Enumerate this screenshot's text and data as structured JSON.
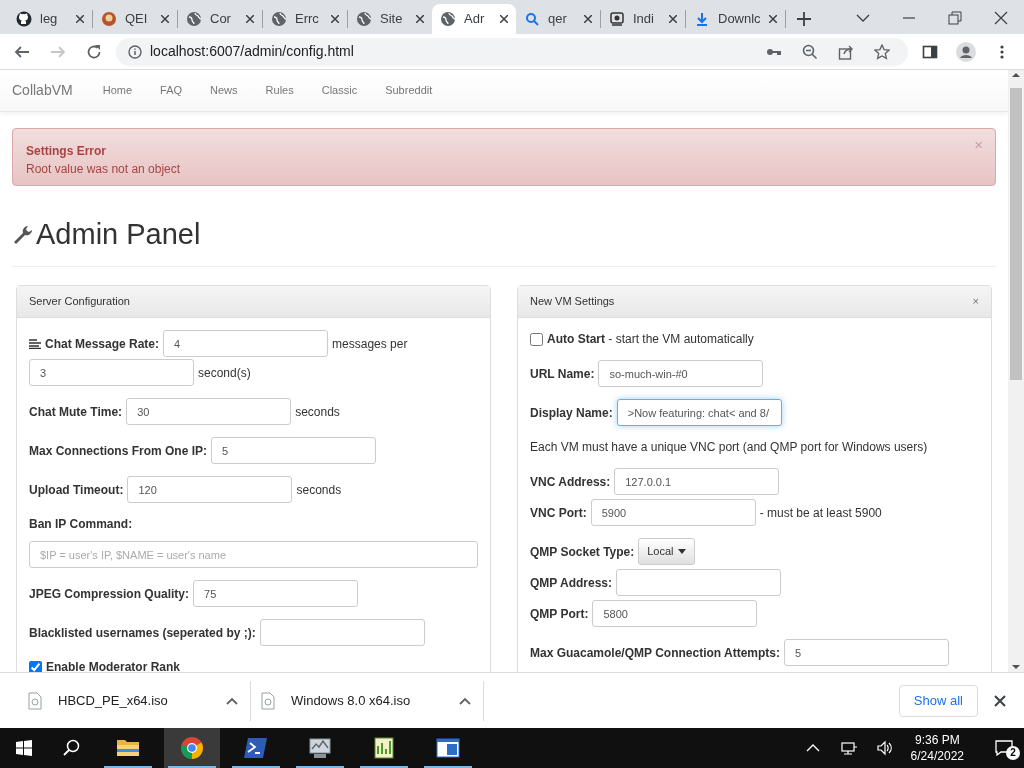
{
  "browser": {
    "tabs": [
      {
        "title": "leg",
        "kind": "github",
        "selected": false
      },
      {
        "title": "QEI",
        "kind": "logo",
        "selected": false
      },
      {
        "title": "Cor",
        "kind": "globe",
        "selected": false
      },
      {
        "title": "Errc",
        "kind": "globe",
        "selected": false
      },
      {
        "title": "Site",
        "kind": "globe",
        "selected": false
      },
      {
        "title": "Adr",
        "kind": "globe",
        "selected": true
      },
      {
        "title": "qer",
        "kind": "search",
        "selected": false
      },
      {
        "title": "Indi",
        "kind": "app",
        "selected": false
      },
      {
        "title": "Downlc",
        "kind": "download",
        "selected": false
      }
    ],
    "forward_disabled": true,
    "address": "localhost:6007/admin/config.html"
  },
  "navbar": {
    "brand": "CollabVM",
    "links": [
      "Home",
      "FAQ",
      "News",
      "Rules",
      "Classic",
      "Subreddit"
    ]
  },
  "alert": {
    "title": "Settings Error",
    "message": "Root value was not an object",
    "close": "×"
  },
  "heading": "Admin Panel",
  "panels": [
    {
      "title": "Server Configuration",
      "groups": [
        [
          [
            {
              "kind": "icon"
            },
            {
              "kind": "label",
              "text": "Chat Message Rate:"
            },
            {
              "kind": "input",
              "value": "4"
            },
            {
              "kind": "text",
              "text": "messages per"
            },
            {
              "kind": "input",
              "value": "3"
            },
            {
              "kind": "text",
              "text": "second(s)"
            }
          ]
        ],
        [
          [
            {
              "kind": "label",
              "text": "Chat Mute Time:"
            },
            {
              "kind": "input",
              "value": "30"
            },
            {
              "kind": "text",
              "text": "seconds"
            }
          ]
        ],
        [
          [
            {
              "kind": "label",
              "text": "Max Connections From One IP:"
            },
            {
              "kind": "input",
              "value": "5"
            }
          ]
        ],
        [
          [
            {
              "kind": "label",
              "text": "Upload Timeout:"
            },
            {
              "kind": "input",
              "value": "120"
            },
            {
              "kind": "text",
              "text": "seconds"
            }
          ]
        ],
        [
          [
            {
              "kind": "label",
              "text": "Ban IP Command:"
            }
          ],
          [
            {
              "kind": "wide-input",
              "placeholder": "$IP = user's IP, $NAME = user's name"
            }
          ]
        ],
        [
          [
            {
              "kind": "label",
              "text": "JPEG Compression Quality:"
            },
            {
              "kind": "input",
              "value": "75"
            }
          ]
        ],
        [
          [
            {
              "kind": "label",
              "text": "Blacklisted usernames (seperated by ;):"
            },
            {
              "kind": "input"
            }
          ]
        ],
        [
          [
            {
              "kind": "checkbox",
              "text": "Enable Moderator Rank",
              "checked": true
            }
          ]
        ]
      ]
    },
    {
      "title": "New VM Settings",
      "close": "×",
      "groups": [
        [
          [
            {
              "kind": "checkbox",
              "text": "**Auto Start** - start the VM automatically",
              "checked": false
            }
          ]
        ],
        [
          [
            {
              "kind": "label",
              "text": "URL Name:"
            },
            {
              "kind": "input",
              "value": "so-much-win-#0",
              "focused": false
            }
          ]
        ],
        [
          [
            {
              "kind": "label",
              "text": "Display Name:"
            },
            {
              "kind": "input",
              "value": ">Now featuring: chat< and 8/",
              "focused": true
            }
          ]
        ],
        [
          [
            {
              "kind": "text",
              "text": "Each VM must have a unique VNC port (and QMP port for Windows users)"
            }
          ]
        ],
        [
          [
            {
              "kind": "label",
              "text": "VNC Address:"
            },
            {
              "kind": "input",
              "value": "127.0.0.1"
            }
          ],
          [
            {
              "kind": "label",
              "text": "VNC Port:"
            },
            {
              "kind": "input",
              "value": "5900"
            },
            {
              "kind": "text",
              "text": "- must be at least 5900"
            }
          ]
        ],
        [
          [
            {
              "kind": "label",
              "text": "QMP Socket Type:"
            },
            {
              "kind": "dropdown",
              "text": "Local"
            }
          ],
          [
            {
              "kind": "label",
              "text": "QMP Address:"
            },
            {
              "kind": "input"
            }
          ],
          [
            {
              "kind": "label",
              "text": "QMP Port:"
            },
            {
              "kind": "input",
              "value": "5800"
            }
          ]
        ],
        [
          [
            {
              "kind": "label",
              "text": "Max Guacamole/QMP Connection Attempts:"
            },
            {
              "kind": "input",
              "value": "5"
            }
          ]
        ]
      ]
    }
  ],
  "downloads": {
    "items": [
      "HBCD_PE_x64.iso",
      "Windows 8.0 x64.iso"
    ],
    "show_all": "Show all"
  },
  "taskbar": {
    "apps": [
      {
        "kind": "folder",
        "running": true,
        "active": false
      },
      {
        "kind": "chrome",
        "running": true,
        "active": true
      },
      {
        "kind": "shell",
        "running": true,
        "active": false
      },
      {
        "kind": "monitor",
        "running": true,
        "active": false
      },
      {
        "kind": "chart",
        "running": true,
        "active": false
      },
      {
        "kind": "window",
        "running": true,
        "active": false
      }
    ],
    "time": "9:36 PM",
    "date": "6/24/2022",
    "notifications": "2"
  }
}
